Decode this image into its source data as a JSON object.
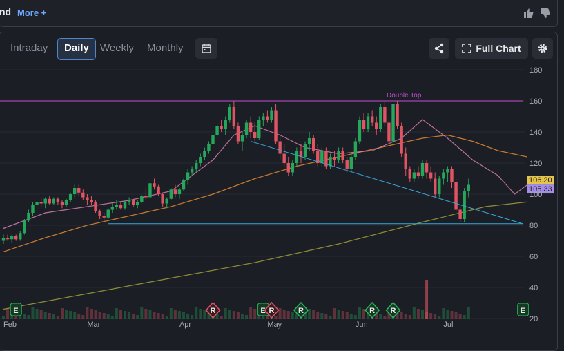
{
  "header": {
    "title": "nd",
    "more_label": "More +"
  },
  "toolbar": {
    "tabs": [
      "Intraday",
      "Daily",
      "Weekly",
      "Monthly"
    ],
    "active_tab": "Daily",
    "full_chart_label": "Full Chart"
  },
  "colors": {
    "up": "#26a65b",
    "down": "#e05563",
    "ma_fast": "#d77fb0",
    "ma_mid": "#e58a32",
    "ma_slow": "#a0a338",
    "trend": "#39a7d8",
    "double_top": "#c54fd3",
    "accent": "#4d86c9"
  },
  "chart_data": {
    "type": "candlestick",
    "ylim": [
      20,
      180
    ],
    "yticks": [
      20,
      40,
      60,
      80,
      100,
      120,
      140,
      160,
      180
    ],
    "xticks": [
      {
        "label": "Feb",
        "x": 0
      },
      {
        "label": "Mar",
        "x": 20
      },
      {
        "label": "Apr",
        "x": 42
      },
      {
        "label": "May",
        "x": 63
      },
      {
        "label": "Jun",
        "x": 84
      },
      {
        "label": "Jul",
        "x": 105
      }
    ],
    "last_price_label": "106.20",
    "last_ma_label": "105.33",
    "annotation": {
      "text": "Double Top",
      "y": 160
    },
    "support_level": 81,
    "earnings_markers": [
      {
        "label": "E",
        "x": 3
      },
      {
        "label": "E",
        "x": 62
      },
      {
        "label": "E",
        "x": 124
      }
    ],
    "rating_markers": [
      {
        "label": "R",
        "x": 50,
        "type": "down"
      },
      {
        "label": "R",
        "x": 64,
        "type": "down"
      },
      {
        "label": "R",
        "x": 71,
        "type": "up"
      },
      {
        "label": "R",
        "x": 88,
        "type": "up"
      },
      {
        "label": "R",
        "x": 93,
        "type": "up"
      }
    ],
    "ohlc": [
      [
        70,
        74,
        68,
        72
      ],
      [
        72,
        74,
        70,
        71
      ],
      [
        71,
        74,
        69,
        73
      ],
      [
        73,
        74,
        70,
        71
      ],
      [
        71,
        76,
        70,
        75
      ],
      [
        75,
        84,
        74,
        83
      ],
      [
        83,
        90,
        82,
        88
      ],
      [
        88,
        95,
        86,
        93
      ],
      [
        93,
        97,
        90,
        95
      ],
      [
        95,
        98,
        92,
        94
      ],
      [
        94,
        98,
        91,
        97
      ],
      [
        97,
        99,
        93,
        94
      ],
      [
        94,
        98,
        93,
        97
      ],
      [
        97,
        98,
        93,
        95
      ],
      [
        95,
        96,
        91,
        93
      ],
      [
        93,
        97,
        92,
        96
      ],
      [
        96,
        101,
        95,
        100
      ],
      [
        100,
        106,
        98,
        104
      ],
      [
        104,
        106,
        99,
        101
      ],
      [
        101,
        103,
        96,
        98
      ],
      [
        98,
        100,
        93,
        96
      ],
      [
        96,
        99,
        93,
        95
      ],
      [
        95,
        96,
        88,
        89
      ],
      [
        89,
        90,
        84,
        86
      ],
      [
        86,
        88,
        82,
        85
      ],
      [
        85,
        91,
        84,
        90
      ],
      [
        90,
        94,
        88,
        92
      ],
      [
        92,
        96,
        90,
        93
      ],
      [
        93,
        95,
        90,
        91
      ],
      [
        91,
        96,
        90,
        95
      ],
      [
        95,
        98,
        93,
        96
      ],
      [
        96,
        97,
        92,
        93
      ],
      [
        93,
        96,
        91,
        95
      ],
      [
        95,
        100,
        94,
        99
      ],
      [
        99,
        104,
        96,
        98
      ],
      [
        98,
        108,
        97,
        107
      ],
      [
        107,
        110,
        103,
        105
      ],
      [
        105,
        106,
        99,
        100
      ],
      [
        100,
        101,
        92,
        94
      ],
      [
        94,
        98,
        91,
        97
      ],
      [
        97,
        104,
        96,
        103
      ],
      [
        103,
        106,
        98,
        100
      ],
      [
        100,
        104,
        97,
        103
      ],
      [
        103,
        110,
        102,
        109
      ],
      [
        109,
        116,
        106,
        114
      ],
      [
        114,
        118,
        112,
        116
      ],
      [
        116,
        122,
        114,
        120
      ],
      [
        120,
        126,
        118,
        124
      ],
      [
        124,
        130,
        122,
        128
      ],
      [
        128,
        134,
        126,
        132
      ],
      [
        132,
        140,
        130,
        138
      ],
      [
        138,
        145,
        136,
        144
      ],
      [
        144,
        148,
        140,
        142
      ],
      [
        142,
        150,
        138,
        148
      ],
      [
        148,
        158,
        146,
        156
      ],
      [
        156,
        160,
        142,
        144
      ],
      [
        144,
        146,
        132,
        134
      ],
      [
        134,
        140,
        128,
        138
      ],
      [
        138,
        148,
        136,
        146
      ],
      [
        146,
        150,
        136,
        140
      ],
      [
        140,
        146,
        134,
        136
      ],
      [
        136,
        150,
        135,
        148
      ],
      [
        148,
        152,
        144,
        150
      ],
      [
        150,
        154,
        146,
        148
      ],
      [
        148,
        156,
        146,
        154
      ],
      [
        154,
        158,
        132,
        134
      ],
      [
        134,
        138,
        122,
        126
      ],
      [
        126,
        132,
        118,
        120
      ],
      [
        120,
        124,
        112,
        114
      ],
      [
        114,
        122,
        112,
        120
      ],
      [
        120,
        130,
        118,
        128
      ],
      [
        128,
        132,
        120,
        124
      ],
      [
        124,
        134,
        122,
        132
      ],
      [
        132,
        140,
        128,
        136
      ],
      [
        136,
        138,
        126,
        128
      ],
      [
        128,
        132,
        118,
        120
      ],
      [
        120,
        130,
        118,
        128
      ],
      [
        128,
        130,
        116,
        118
      ],
      [
        118,
        126,
        116,
        124
      ],
      [
        124,
        128,
        118,
        122
      ],
      [
        122,
        130,
        120,
        128
      ],
      [
        128,
        130,
        120,
        122
      ],
      [
        122,
        124,
        114,
        116
      ],
      [
        116,
        126,
        114,
        124
      ],
      [
        124,
        136,
        122,
        134
      ],
      [
        134,
        150,
        132,
        148
      ],
      [
        148,
        152,
        140,
        142
      ],
      [
        142,
        152,
        140,
        150
      ],
      [
        150,
        154,
        144,
        146
      ],
      [
        146,
        150,
        138,
        142
      ],
      [
        142,
        158,
        140,
        156
      ],
      [
        156,
        160,
        144,
        146
      ],
      [
        146,
        150,
        132,
        134
      ],
      [
        134,
        160,
        132,
        158
      ],
      [
        158,
        160,
        142,
        144
      ],
      [
        144,
        146,
        124,
        126
      ],
      [
        126,
        130,
        112,
        116
      ],
      [
        116,
        118,
        108,
        110
      ],
      [
        110,
        116,
        108,
        114
      ],
      [
        114,
        118,
        110,
        112
      ],
      [
        112,
        122,
        110,
        120
      ],
      [
        120,
        122,
        110,
        114
      ],
      [
        114,
        118,
        108,
        110
      ],
      [
        110,
        114,
        98,
        100
      ],
      [
        100,
        112,
        98,
        110
      ],
      [
        110,
        116,
        106,
        114
      ],
      [
        114,
        118,
        108,
        116
      ],
      [
        116,
        118,
        104,
        108
      ],
      [
        108,
        110,
        88,
        90
      ],
      [
        90,
        92,
        82,
        84
      ],
      [
        84,
        104,
        82,
        102
      ],
      [
        102,
        110,
        98,
        106
      ]
    ],
    "ma_fast": [
      [
        0,
        78
      ],
      [
        10,
        88
      ],
      [
        20,
        92
      ],
      [
        30,
        96
      ],
      [
        40,
        102
      ],
      [
        50,
        122
      ],
      [
        55,
        138
      ],
      [
        60,
        144
      ],
      [
        66,
        138
      ],
      [
        72,
        130
      ],
      [
        80,
        126
      ],
      [
        88,
        128
      ],
      [
        95,
        136
      ],
      [
        100,
        148
      ],
      [
        106,
        136
      ],
      [
        112,
        122
      ],
      [
        118,
        112
      ],
      [
        122,
        100
      ],
      [
        125,
        106
      ]
    ],
    "ma_mid": [
      [
        0,
        63
      ],
      [
        10,
        72
      ],
      [
        20,
        80
      ],
      [
        30,
        86
      ],
      [
        40,
        92
      ],
      [
        50,
        100
      ],
      [
        60,
        110
      ],
      [
        70,
        118
      ],
      [
        80,
        124
      ],
      [
        90,
        130
      ],
      [
        100,
        136
      ],
      [
        106,
        138
      ],
      [
        112,
        134
      ],
      [
        118,
        128
      ],
      [
        125,
        124
      ]
    ],
    "ma_slow": [
      [
        0,
        26
      ],
      [
        20,
        36
      ],
      [
        40,
        46
      ],
      [
        60,
        56
      ],
      [
        80,
        68
      ],
      [
        100,
        82
      ],
      [
        115,
        92
      ],
      [
        125,
        95
      ]
    ]
  }
}
